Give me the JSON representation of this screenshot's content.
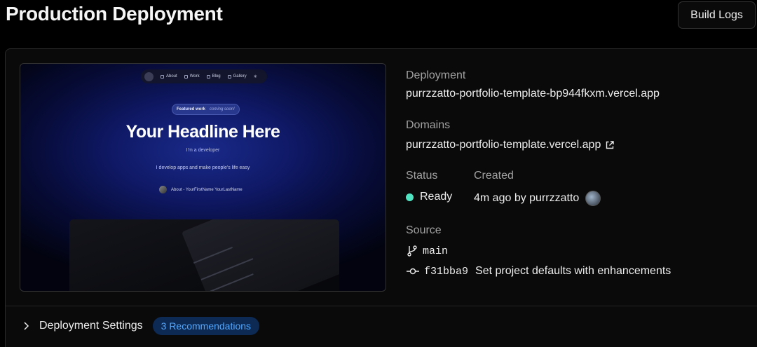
{
  "header": {
    "title": "Production Deployment",
    "build_logs_label": "Build Logs"
  },
  "preview": {
    "nav_items": [
      "About",
      "Work",
      "Blog",
      "Gallery"
    ],
    "pill_featured": "Featured work",
    "pill_soon": "coming soon!",
    "headline": "Your Headline Here",
    "subtitle": "I'm a developer",
    "description": "I develop apps and make people's life easy",
    "author": "About - YourFirstName YourLastName"
  },
  "deployment": {
    "label": "Deployment",
    "url": "purrzzatto-portfolio-template-bp944fkxm.vercel.app"
  },
  "domains": {
    "label": "Domains",
    "url": "purrzzatto-portfolio-template.vercel.app"
  },
  "status": {
    "label": "Status",
    "value": "Ready",
    "color": "#50e3c2"
  },
  "created": {
    "label": "Created",
    "value": "4m ago by purrzzatto"
  },
  "source": {
    "label": "Source",
    "branch": "main",
    "commit_hash": "f31bba9",
    "commit_message": "Set project defaults with enhancements"
  },
  "settings": {
    "label": "Deployment Settings",
    "recommendations": "3 Recommendations"
  },
  "icons": {
    "external_link": "external-link-icon",
    "branch": "git-branch-icon",
    "commit": "git-commit-icon",
    "chevron": "chevron-right-icon"
  }
}
